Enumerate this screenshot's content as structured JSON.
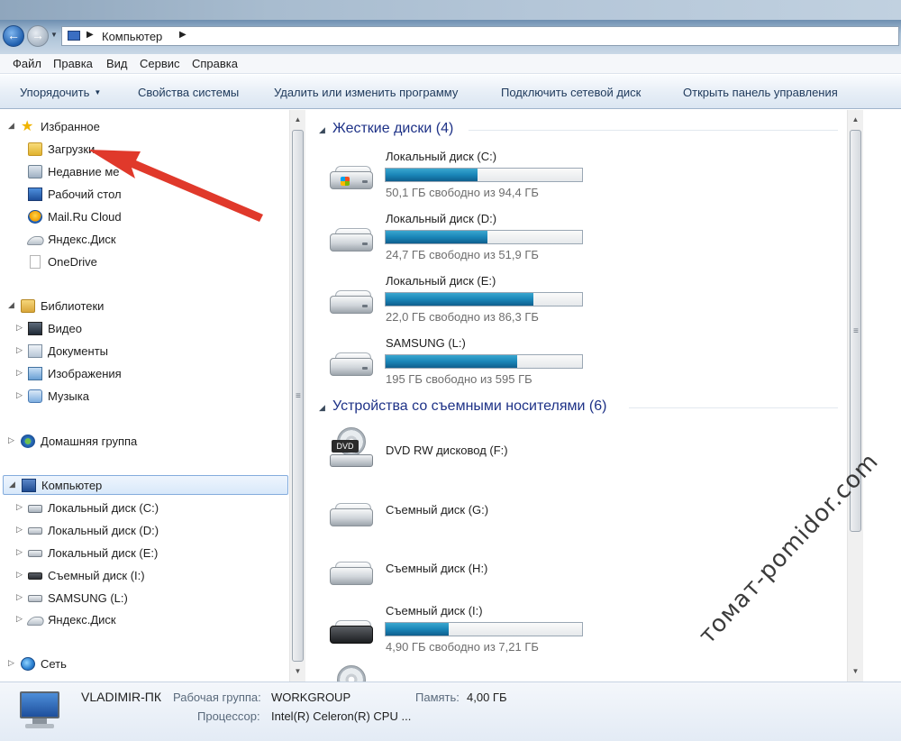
{
  "address": {
    "crumb": "Компьютер"
  },
  "menu": [
    "Файл",
    "Правка",
    "Вид",
    "Сервис",
    "Справка"
  ],
  "toolbar": {
    "organize": "Упорядочить",
    "system_properties": "Свойства системы",
    "uninstall": "Удалить или изменить программу",
    "map_drive": "Подключить сетевой диск",
    "control_panel": "Открыть панель управления"
  },
  "nav": {
    "favorites": "Избранное",
    "downloads": "Загрузки",
    "recent": "Недавние ме",
    "desktop": "Рабочий стол",
    "mailru": "Mail.Ru Cloud",
    "yadisk": "Яндекс.Диск",
    "onedrive": "OneDrive",
    "libraries": "Библиотеки",
    "video": "Видео",
    "documents": "Документы",
    "images": "Изображения",
    "music": "Музыка",
    "homegroup": "Домашняя группа",
    "computer": "Компьютер",
    "drive_c": "Локальный диск (C:)",
    "drive_d": "Локальный диск (D:)",
    "drive_e": "Локальный диск (E:)",
    "drive_i": "Съемный диск (I:)",
    "drive_l": "SAMSUNG (L:)",
    "yadisk2": "Яндекс.Диск",
    "network": "Сеть"
  },
  "content": {
    "hdd_header": "Жесткие диски (4)",
    "removable_header": "Устройства со съемными носителями (6)",
    "hdd": [
      {
        "name": "Локальный диск (C:)",
        "free": "50,1 ГБ свободно из 94,4 ГБ",
        "used_fraction": 0.47
      },
      {
        "name": "Локальный диск (D:)",
        "free": "24,7 ГБ свободно из 51,9 ГБ",
        "used_fraction": 0.52
      },
      {
        "name": "Локальный диск (E:)",
        "free": "22,0 ГБ свободно из 86,3 ГБ",
        "used_fraction": 0.75
      },
      {
        "name": "SAMSUNG (L:)",
        "free": "195 ГБ свободно из 595 ГБ",
        "used_fraction": 0.67
      }
    ],
    "removable": [
      {
        "name": "DVD RW дисковод (F:)",
        "icon_text": "DVD"
      },
      {
        "name": "Съемный диск (G:)"
      },
      {
        "name": "Съемный диск (H:)"
      },
      {
        "name": "Съемный диск (I:)",
        "free": "4,90 ГБ свободно из 7,21 ГБ",
        "used_fraction": 0.32
      }
    ]
  },
  "details": {
    "pc_name": "VLADIMIR-ПК",
    "workgroup_label": "Рабочая группа:",
    "workgroup_value": "WORKGROUP",
    "memory_label": "Память:",
    "memory_value": "4,00 ГБ",
    "cpu_label": "Процессор:",
    "cpu_value": "Intel(R) Celeron(R) CPU ..."
  },
  "watermark": "томат-pomidor.com",
  "colors": {
    "accent_header": "#1e3287",
    "bar_fill": "#1a86b8",
    "annotation_arrow": "#e0392b"
  }
}
